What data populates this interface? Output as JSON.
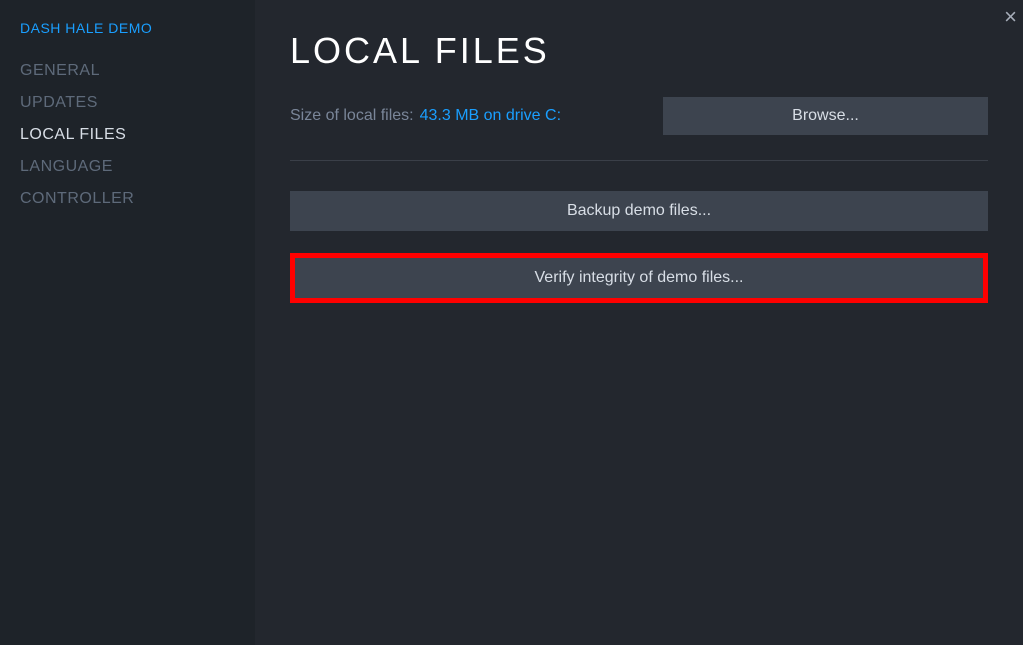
{
  "header": {
    "app_title": "DASH HALE DEMO"
  },
  "sidebar": {
    "items": [
      {
        "label": "GENERAL"
      },
      {
        "label": "UPDATES"
      },
      {
        "label": "LOCAL FILES"
      },
      {
        "label": "LANGUAGE"
      },
      {
        "label": "CONTROLLER"
      }
    ]
  },
  "main": {
    "title": "LOCAL FILES",
    "size_label": "Size of local files:",
    "size_value": "43.3 MB on drive C:",
    "browse_label": "Browse...",
    "backup_label": "Backup demo files...",
    "verify_label": "Verify integrity of demo files..."
  }
}
